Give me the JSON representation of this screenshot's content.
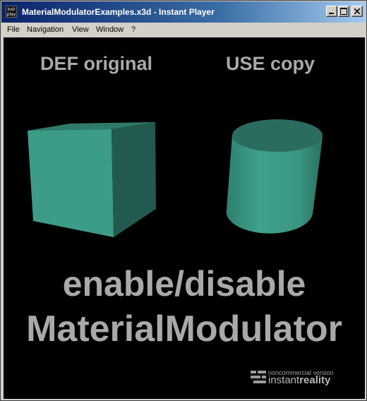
{
  "window": {
    "title": "MaterialModulatorExamples.x3d - Instant Player",
    "app_icon_text": "inst play",
    "buttons": [
      "minimize",
      "maximize",
      "close"
    ]
  },
  "menu": {
    "items": [
      "File",
      "Navigation",
      "View",
      "Window",
      "?"
    ]
  },
  "scene": {
    "label_left": "DEF original",
    "label_right": "USE copy",
    "caption_line1": "enable/disable",
    "caption_line2": "MaterialModulator",
    "shape_left": "cube",
    "shape_right": "cylinder",
    "material_color": "#3a9a86",
    "background_color": "#000000"
  },
  "watermark": {
    "line1": "noncommercial version",
    "brand_light": "instant",
    "brand_bold": "reality"
  }
}
